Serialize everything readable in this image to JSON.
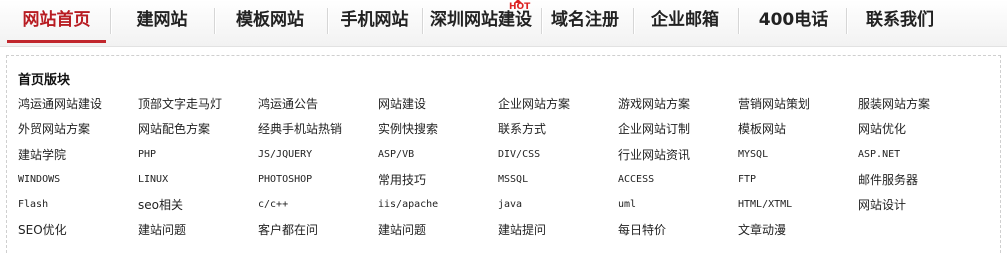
{
  "nav": {
    "items": [
      {
        "label": "网站首页",
        "active": true
      },
      {
        "label": "建网站"
      },
      {
        "label": "模板网站"
      },
      {
        "label": "手机网站"
      },
      {
        "label": "深圳网站建设"
      },
      {
        "label": "域名注册"
      },
      {
        "label": "企业邮箱"
      },
      {
        "label": "400电话"
      },
      {
        "label": "联系我们"
      }
    ],
    "hot_badge": "HOT"
  },
  "panel": {
    "title": "首页版块",
    "rows": [
      [
        "鸿运通网站建设",
        "顶部文字走马灯",
        "鸿运通公告",
        "网站建设",
        "企业网站方案",
        "游戏网站方案",
        "营销网站策划",
        "服装网站方案"
      ],
      [
        "外贸网站方案",
        "网站配色方案",
        "经典手机站热销",
        "实例快搜索",
        "联系方式",
        "企业网站订制",
        "模板网站",
        "网站优化"
      ],
      [
        "建站学院",
        "PHP",
        "JS/JQUERY",
        "ASP/VB",
        "DIV/CSS",
        "行业网站资讯",
        "MYSQL",
        "ASP.NET"
      ],
      [
        "WINDOWS",
        "LINUX",
        "PHOTOSHOP",
        "常用技巧",
        "MSSQL",
        "ACCESS",
        "FTP",
        "邮件服务器"
      ],
      [
        "Flash",
        "seo相关",
        "c/c++",
        "iis/apache",
        "java",
        "uml",
        "HTML/XTML",
        "网站设计"
      ],
      [
        "SEO优化",
        "建站问题",
        "客户都在问",
        "建站问题",
        "建站提问",
        "每日特价",
        "文章动漫"
      ]
    ]
  },
  "colors": {
    "accent": "#c1272d",
    "text": "#222222"
  }
}
